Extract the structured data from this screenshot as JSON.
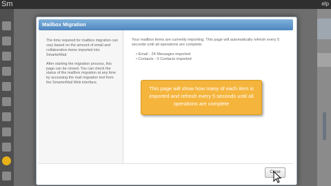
{
  "app": {
    "title": "Sm",
    "help_label": "elp"
  },
  "dialog": {
    "title": "Mailbox Migration",
    "left_paragraphs": [
      "The time required for mailbox migration can vary based on the amount of email and collaboration items imported into SmarterMail.",
      "After starting the migration process, this page can be closed. You can check the status of the mailbox migration at any time by accessing the mail migration tool from the SmarterMail Web interface."
    ],
    "status_text": "Your mailbox items are currently importing. This page will automatically refresh every 5 seconds until all operations are complete.",
    "items": [
      "Email - 24 Messages imported",
      "Contacts - 0 Contacts imported"
    ],
    "callout_text": "This page will show how many of each item is imported and refresh every 5 seconds until all operations are complete",
    "close_label": "Close"
  },
  "colors": {
    "header": "#5b93c8",
    "callout": "#f5b43c",
    "overlay": "#6e6e6e"
  }
}
